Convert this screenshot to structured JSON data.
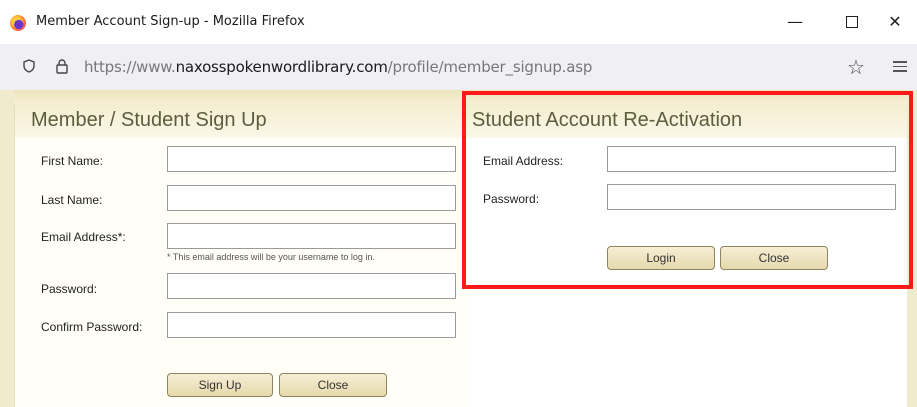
{
  "window": {
    "title": "Member Account Sign-up - Mozilla Firefox",
    "minimize": "—",
    "close": "✕"
  },
  "urlbar": {
    "url_prefix": "https://www.",
    "url_domain": "naxosspokenwordlibrary.com",
    "url_path": "/profile/member_signup.asp"
  },
  "signup": {
    "title": "Member / Student Sign Up",
    "first_name_label": "First Name:",
    "last_name_label": "Last Name:",
    "email_label": "Email Address*:",
    "email_note": "* This email address will be your username to log in.",
    "password_label": "Password:",
    "confirm_password_label": "Confirm Password:",
    "signup_button": "Sign Up",
    "close_button": "Close"
  },
  "reactivation": {
    "title": "Student Account Re-Activation",
    "email_label": "Email Address:",
    "password_label": "Password:",
    "login_button": "Login",
    "close_button": "Close"
  },
  "highlight_color": "#ff1a1a"
}
